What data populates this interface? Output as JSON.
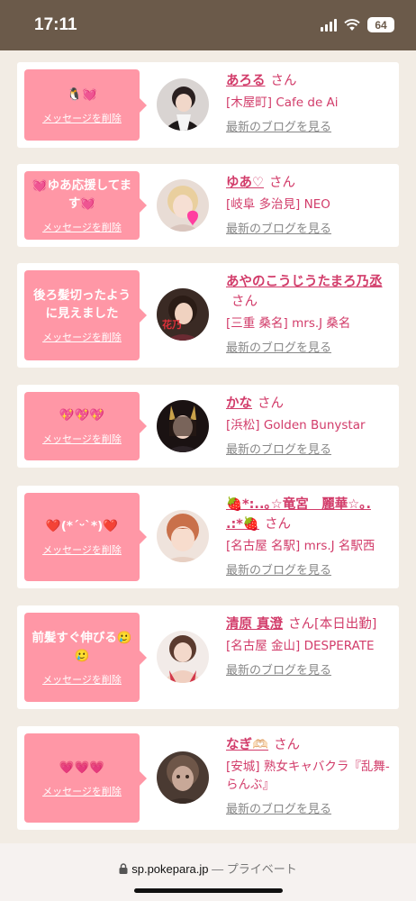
{
  "status_bar": {
    "time": "17:11",
    "battery": "64"
  },
  "browser": {
    "domain": "sp.pokepara.jp",
    "mode": "— プライベート"
  },
  "messages": [
    {
      "message": "🐧💓",
      "delete_label": "メッセージを削除",
      "name": "あろる",
      "suffix": "さん",
      "shop": "[木屋町] Cafe de Ai",
      "blog_label": "最新のブログを見る"
    },
    {
      "message": "💓ゆあ応援してます💓",
      "delete_label": "メッセージを削除",
      "name": "ゆあ♡",
      "suffix": "さん",
      "shop": "[岐阜 多治見] NEO",
      "blog_label": "最新のブログを見る"
    },
    {
      "message": "後ろ髪切ったように見えました",
      "delete_label": "メッセージを削除",
      "name": "あやのこうじうたまろ乃丞",
      "suffix": "さん",
      "shop": "[三重 桑名] mrs.J 桑名",
      "blog_label": "最新のブログを見る"
    },
    {
      "message": "💖💖💖",
      "delete_label": "メッセージを削除",
      "name": "かな",
      "suffix": "さん",
      "shop": "[浜松] Golden Bunystar",
      "blog_label": "最新のブログを見る"
    },
    {
      "message": "❤️(*´ᵕ`*)❤️",
      "delete_label": "メッセージを削除",
      "name": "🍓*:..｡☆竜宮　麗華☆｡. .:*🍓",
      "suffix": "さん",
      "shop": "[名古屋 名駅] mrs.J 名駅西",
      "blog_label": "最新のブログを見る"
    },
    {
      "message": "前髪すぐ伸びる🥲🥲",
      "delete_label": "メッセージを削除",
      "name": "清原 真澄",
      "suffix": "さん[本日出勤]",
      "shop": "[名古屋 金山] DESPERATE",
      "blog_label": "最新のブログを見る"
    },
    {
      "message": "💗💗💗",
      "delete_label": "メッセージを削除",
      "name": "なぎ🫶🏻",
      "suffix": "さん",
      "shop": "[安城] 熟女キャバクラ『乱舞-らんぶ』",
      "blog_label": "最新のブログを見る"
    }
  ]
}
